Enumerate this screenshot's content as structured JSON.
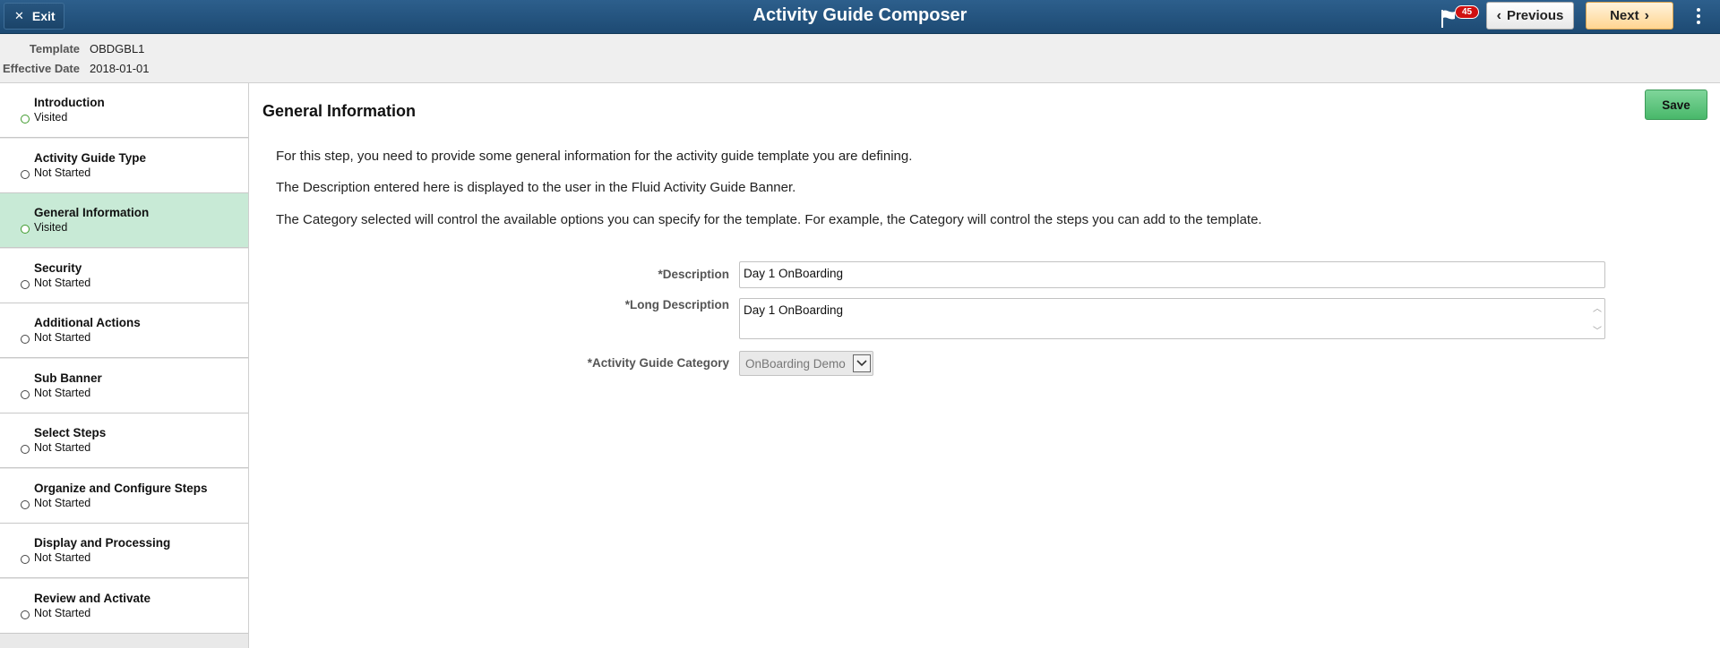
{
  "banner": {
    "exit_label": "Exit",
    "title": "Activity Guide Composer",
    "notification_count": "45",
    "previous_label": "Previous",
    "next_label": "Next"
  },
  "header": {
    "template_label": "Template",
    "template_value": "OBDGBL1",
    "effdt_label": "Effective Date",
    "effdt_value": "2018-01-01"
  },
  "steps": [
    {
      "name": "Introduction",
      "status": "Visited"
    },
    {
      "name": "Activity Guide Type",
      "status": "Not Started"
    },
    {
      "name": "General Information",
      "status": "Visited"
    },
    {
      "name": "Security",
      "status": "Not Started"
    },
    {
      "name": "Additional Actions",
      "status": "Not Started"
    },
    {
      "name": "Sub Banner",
      "status": "Not Started"
    },
    {
      "name": "Select Steps",
      "status": "Not Started"
    },
    {
      "name": "Organize and Configure Steps",
      "status": "Not Started"
    },
    {
      "name": "Display and Processing",
      "status": "Not Started"
    },
    {
      "name": "Review and Activate",
      "status": "Not Started"
    }
  ],
  "main": {
    "title": "General Information",
    "save_label": "Save",
    "paragraphs": [
      "For this step, you need to provide some general information for the activity guide template you are defining.",
      "The Description entered here is displayed to the user in the Fluid Activity Guide Banner.",
      "The Category selected will control the available options you can specify for the template. For example, the Category will control the steps you can add to the template."
    ],
    "description_label": "*Description",
    "description_value": "Day 1 OnBoarding",
    "long_description_label": "*Long Description",
    "long_description_value": "Day 1 OnBoarding",
    "category_label": "*Activity Guide Category",
    "category_value": "OnBoarding Demo"
  },
  "colors": {
    "banner": "#1d4a73",
    "active_step": "#c8ead6",
    "save_button": "#48b86a",
    "next_button": "#ffd591",
    "badge": "#d01010"
  }
}
